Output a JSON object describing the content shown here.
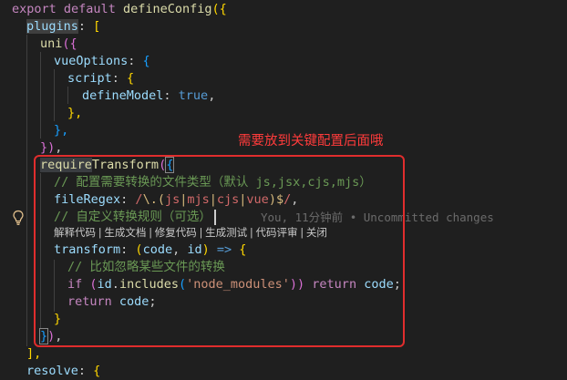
{
  "code": {
    "l1": [
      "export",
      "default",
      "defineConfig",
      "({"
    ],
    "l2": [
      "plugins",
      ": ",
      "["
    ],
    "l3": [
      "uni",
      "({"
    ],
    "l4": [
      "vueOptions",
      ": ",
      "{"
    ],
    "l5": [
      "script",
      ": ",
      "{"
    ],
    "l6": [
      "defineModel",
      ": ",
      "true",
      ","
    ],
    "l7": [
      "},"
    ],
    "l8": [
      "},"
    ],
    "l9": [
      "})",
      ","
    ],
    "l10": [
      "require",
      "Transform",
      "(",
      "{"
    ],
    "l11": "// 配置需要转换的文件类型（默认 js,jsx,cjs,mjs）",
    "l12": [
      "fileRegex",
      ": ",
      "/",
      "\\.(",
      "js",
      "|",
      "mjs",
      "|",
      "cjs",
      "|",
      "vue",
      ")",
      "$",
      "/",
      ","
    ],
    "l13": "// 自定义转换规则（可选）",
    "l14": [
      "transform",
      ": ",
      "(",
      "code",
      ", ",
      "id",
      ") ",
      "=>",
      " {"
    ],
    "l15": "// 比如忽略某些文件的转换",
    "l16": [
      "if",
      " (",
      "id",
      ".",
      "includes",
      "(",
      "'node_modules'",
      "))",
      " return",
      " code",
      ";"
    ],
    "l17": [
      "return",
      " code",
      ";"
    ],
    "l18": [
      "}"
    ],
    "l19": [
      "}",
      ")",
      ","
    ],
    "l20": [
      "],"
    ],
    "l21": [
      "resolve",
      ": ",
      "{"
    ]
  },
  "codelens": "解释代码 | 生成文档 | 修复代码 | 生成测试 | 代码评审 | 关闭",
  "blame": "You, 11分钟前 • Uncommitted changes",
  "annotation": "需要放到关键配置后面哦",
  "icons": {
    "lightbulb": "lightbulb-icon"
  },
  "colors": {
    "annotation": "#e02d2d",
    "background": "#1f1f1f"
  }
}
